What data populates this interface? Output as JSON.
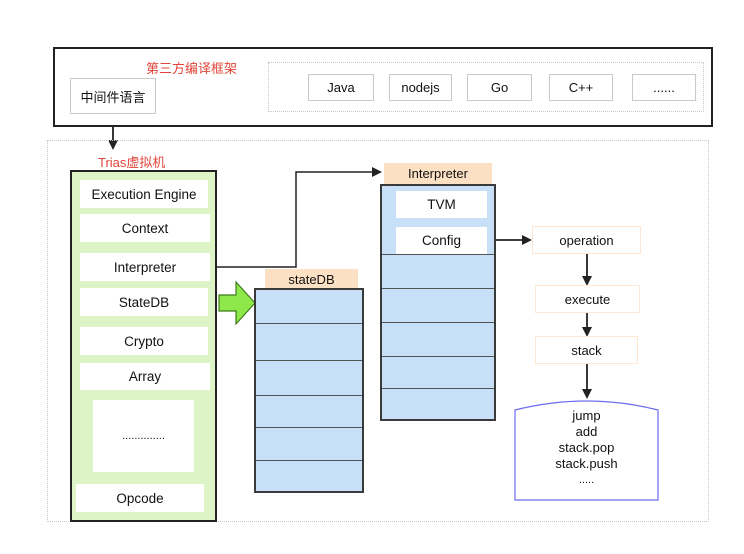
{
  "top": {
    "title": "第三方编译框架",
    "middleware": "中间件语言",
    "languages": [
      "Java",
      "nodejs",
      "Go",
      "C++",
      "......"
    ]
  },
  "vm": {
    "title": "Trias虚拟机",
    "modules": [
      "Execution Engine",
      "Context",
      "Interpreter",
      "StateDB",
      "Crypto",
      "Array",
      "..............",
      "Opcode"
    ]
  },
  "statedb": {
    "label": "stateDB"
  },
  "interpreter": {
    "label": "Interpreter",
    "items": [
      "TVM",
      "Config"
    ]
  },
  "flow": {
    "steps": [
      "operation",
      "execute",
      "stack"
    ],
    "ops": [
      "jump",
      "add",
      "stack.pop",
      "stack.push",
      "....."
    ]
  },
  "colors": {
    "title_red": "#e0453a",
    "module_green": "#ddf5c6",
    "table_blue": "#c7e0f7",
    "label_peach": "#fce0c4",
    "arrow_green": "#8ee84a",
    "ops_border": "#6c6cf0"
  }
}
